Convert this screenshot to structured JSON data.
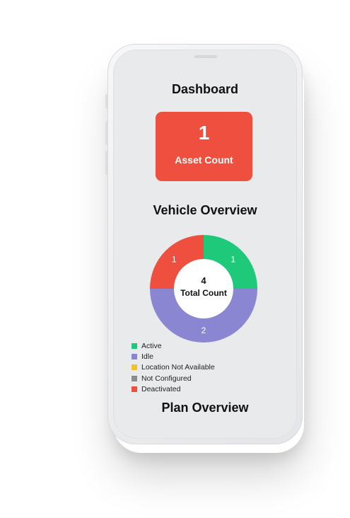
{
  "header": {
    "title": "Dashboard"
  },
  "asset_card": {
    "value": "1",
    "label": "Asset Count"
  },
  "vehicle_overview": {
    "title": "Vehicle Overview",
    "total_value": "4",
    "total_label": "Total Count"
  },
  "plan_overview": {
    "title": "Plan Overview"
  },
  "chart_data": {
    "type": "pie",
    "title": "Vehicle Overview",
    "center_value": 4,
    "center_label": "Total Count",
    "categories": [
      "Active",
      "Idle",
      "Location Not Available",
      "Not Configured",
      "Deactivated"
    ],
    "values": [
      1,
      2,
      0,
      0,
      1
    ],
    "colors": [
      "#1ec97a",
      "#8b86d2",
      "#f2c12e",
      "#8c8c8c",
      "#ee4f3e"
    ],
    "legend_position": "bottom-left"
  }
}
